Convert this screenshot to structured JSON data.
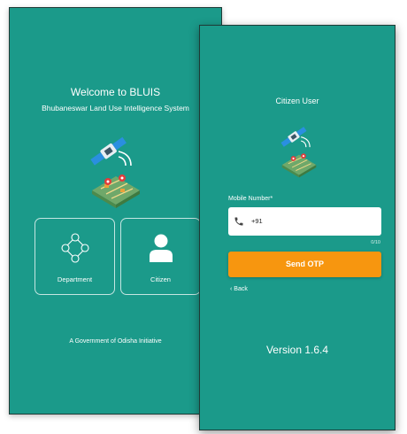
{
  "department_screen": {
    "welcome_title": "Welcome to BLUIS",
    "subtitle": "Bhubaneswar Land Use Intelligence System",
    "roles": [
      {
        "label": "Department",
        "icon": "network-users-icon"
      },
      {
        "label": "Citizen",
        "icon": "user-silhouette-icon"
      }
    ],
    "footer": "A Government of Odisha Initiative"
  },
  "citizen_screen": {
    "title": "Citizen User",
    "mobile_label": "Mobile Number*",
    "phone_prefix": "+91",
    "char_counter": "0/10",
    "send_otp_label": "Send OTP",
    "back_label": "Back",
    "version": "Version 1.6.4"
  },
  "colors": {
    "background_teal": "#1b9a8a",
    "button_orange": "#f7960f",
    "satellite_blue": "#2a8fe0",
    "map_green": "#6fa86a",
    "pin_red": "#e23b3b"
  },
  "icons": [
    "satellite-map-illustration",
    "phone-icon",
    "chevron-left-icon"
  ]
}
